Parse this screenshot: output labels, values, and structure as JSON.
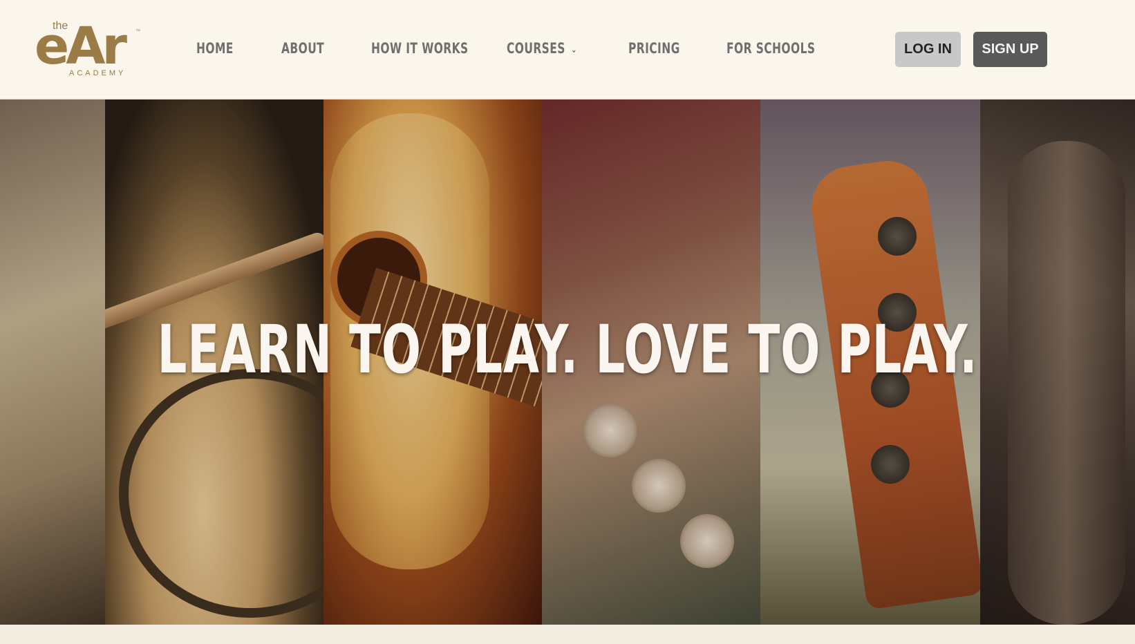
{
  "brand": {
    "logo_the": "the",
    "logo_ear": "eAr",
    "logo_tm": "™",
    "logo_academy": "ACADEMY",
    "color": "#9b7b46"
  },
  "nav": {
    "home": "HOME",
    "about": "ABOUT",
    "how_it_works": "HOW IT WORKS",
    "courses": "COURSES",
    "courses_icon": "chevron-down-icon",
    "pricing": "PRICING",
    "for_schools": "FOR SCHOOLS"
  },
  "auth": {
    "login": "LOG IN",
    "signup": "SIGN UP"
  },
  "hero": {
    "headline": "LEARN TO PLAY. LOVE TO PLAY.",
    "panels": [
      "piano",
      "drums",
      "guitar",
      "trumpet",
      "bass-guitar",
      "saxophone"
    ]
  },
  "colors": {
    "header_bg": "#fbf6ec",
    "nav_text": "#6f6f6f",
    "login_bg": "#c8c8c8",
    "signup_bg": "#595959"
  }
}
